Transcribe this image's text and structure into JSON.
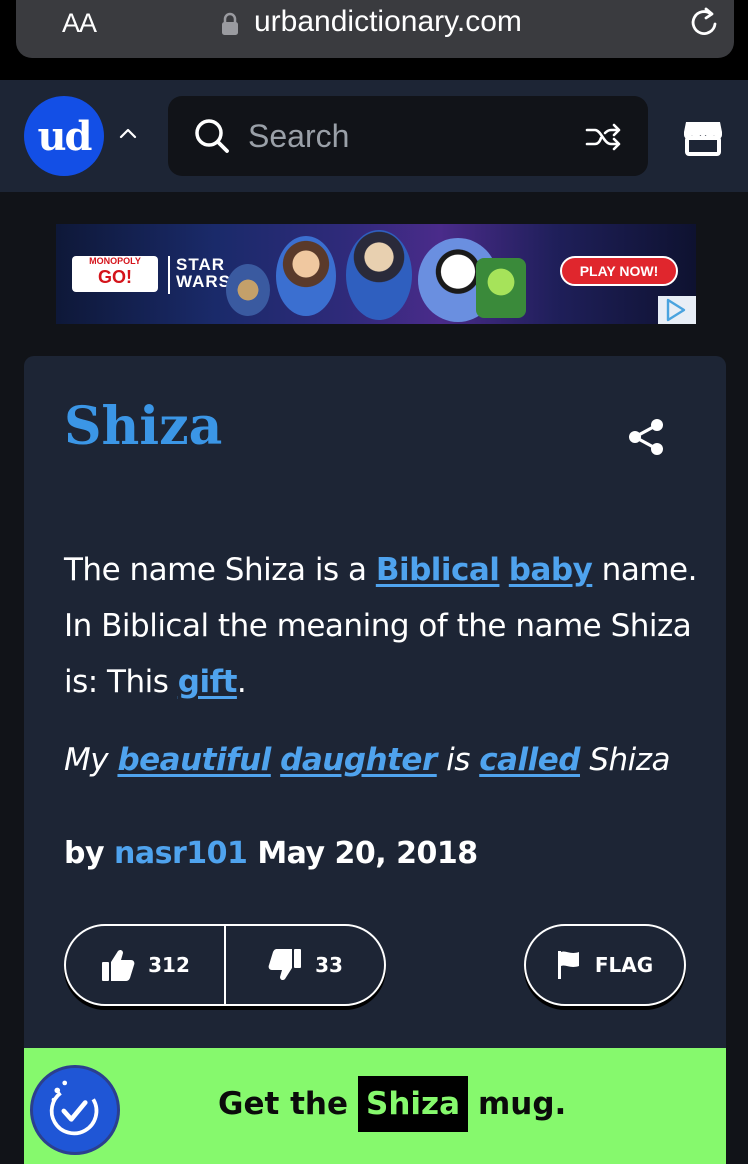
{
  "browser": {
    "aa_label": "AA",
    "url": "urbandictionary.com"
  },
  "header": {
    "logo_text": "ud",
    "search_placeholder": "Search"
  },
  "ad": {
    "brand_small": "MONOPOLY",
    "brand_big": "GO!",
    "partner_line1": "STAR",
    "partner_line2": "WARS",
    "cta": "PLAY NOW!"
  },
  "definition": {
    "word": "Shiza",
    "meaning": {
      "t1": "The name Shiza is a ",
      "l1": "Biblical",
      "t2": " ",
      "l2": "baby",
      "t3": " name. In Biblical the meaning of the name Shiza is: This ",
      "l3": "gift",
      "t4": "."
    },
    "example": {
      "t1": "My ",
      "l1": "beautiful",
      "t2": " ",
      "l2": "daughter",
      "t3": " is ",
      "l3": "called",
      "t4": " Shiza"
    },
    "by_label": "by",
    "author": "nasr101",
    "date": "May 20, 2018",
    "upvotes": "312",
    "downvotes": "33",
    "flag_label": "FLAG"
  },
  "mug": {
    "prefix": "Get the",
    "word": "Shiza",
    "suffix": "mug."
  },
  "colors": {
    "accent_blue": "#3b96e6",
    "card_bg": "#1d2535",
    "mug_green": "#86f96d"
  },
  "icons": [
    "lock-icon",
    "reload-icon",
    "chevron-up-icon",
    "search-icon",
    "shuffle-icon",
    "store-icon",
    "share-icon",
    "thumbs-up-icon",
    "thumbs-down-icon",
    "flag-icon",
    "mug-checkmark-icon"
  ]
}
